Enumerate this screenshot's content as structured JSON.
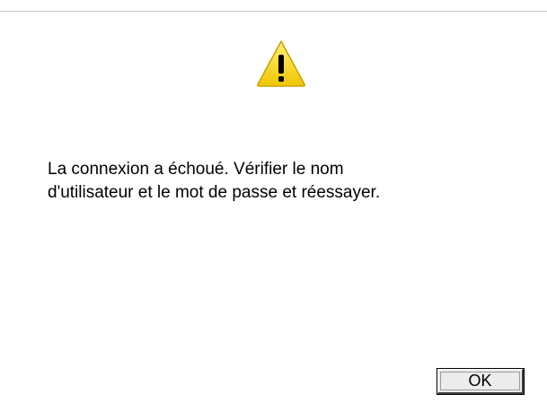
{
  "dialog": {
    "icon": "warning-icon",
    "icon_color": "#f5d000",
    "message_lines": [
      "La connexion a échoué. Vérifier le nom",
      "d'utilisateur et le mot de passe et réessayer."
    ],
    "ok_label": "OK"
  }
}
